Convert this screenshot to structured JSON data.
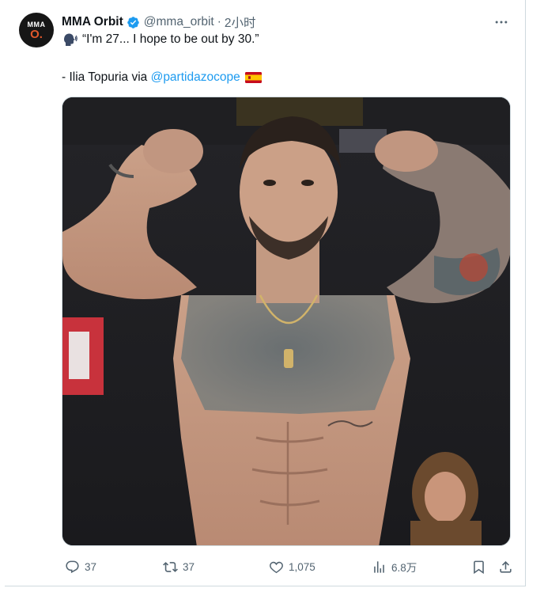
{
  "post": {
    "avatar": {
      "line1": "MMA",
      "line2": "O."
    },
    "author_name": "MMA Orbit",
    "handle": "@mma_orbit",
    "separator": "·",
    "time": "2小时",
    "text_line1": "“I'm 27... I hope to be out by 30.”",
    "attribution_prefix": "- Ilia Topuria via ",
    "attribution_mention": "@partidazocope",
    "icons": {
      "verified": "verified-badge-icon",
      "speaker": "speaking-head-emoji-icon",
      "flag": "spain-flag-emoji-icon",
      "more": "more-dots-icon"
    },
    "colors": {
      "accent": "#1d9bf0",
      "muted": "#536471",
      "text": "#0f1419"
    }
  },
  "actions": {
    "reply_count": "37",
    "retweet_count": "37",
    "like_count": "1,075",
    "view_count": "6.8万"
  }
}
